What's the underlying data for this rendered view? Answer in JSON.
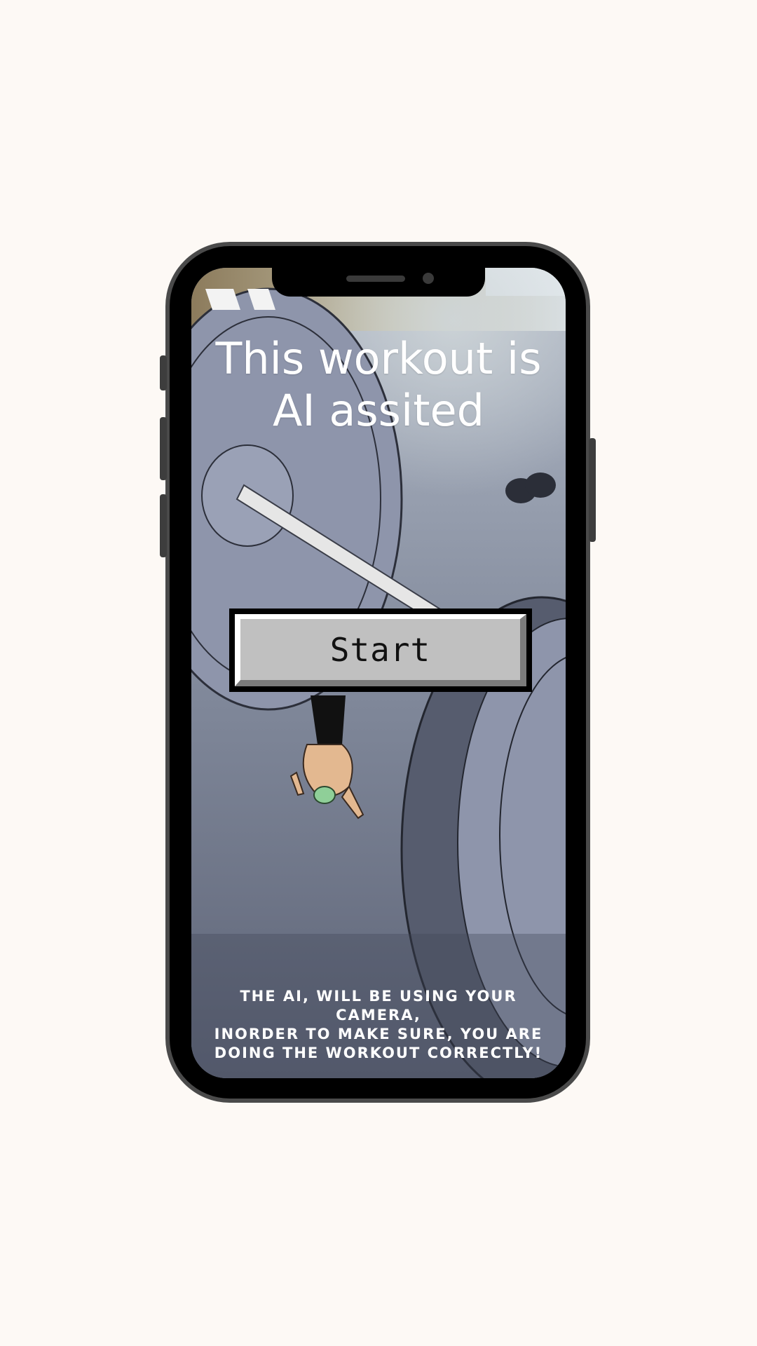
{
  "screen": {
    "title_line1": "This workout is",
    "title_line2": "AI assited",
    "start_button_label": "Start",
    "footer_line1": "THE AI, WILL BE USING YOUR CAMERA,",
    "footer_line2": "INORDER TO MAKE SURE, YOU ARE",
    "footer_line3": "DOING THE WORKOUT CORRECTLY!"
  },
  "colors": {
    "page_background": "#fdf9f5",
    "phone_frame": "#4a4a4a",
    "button_face": "#c0c0c0",
    "text": "#ffffff"
  },
  "background_image": {
    "subject": "anime-gym-barbell-illustration"
  }
}
